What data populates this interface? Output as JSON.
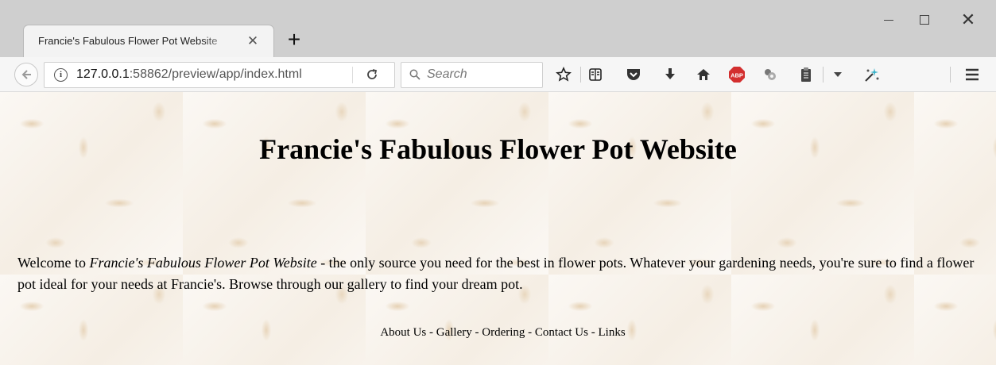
{
  "browser": {
    "tab": {
      "title": "Francie's Fabulous Flower Pot Website",
      "close_glyph": "✕"
    },
    "new_tab_glyph": "+",
    "window_controls": {
      "minimize": "",
      "maximize": "",
      "close": "✕"
    },
    "address": {
      "host": "127.0.0.1",
      "rest": ":58862/preview/app/index.html"
    },
    "search": {
      "placeholder": "Search"
    },
    "toolbar_icons": [
      "star-icon",
      "reading-list-icon",
      "pocket-icon",
      "download-icon",
      "home-icon",
      "adblock-icon",
      "extension-icon",
      "clipboard-icon",
      "dropdown-icon",
      "sparkle-extension-icon",
      "menu-icon"
    ],
    "adblock_label": "ABP"
  },
  "page": {
    "title": "Francie's Fabulous Flower Pot Website",
    "intro": {
      "before": "Welcome to ",
      "emphasis": "Francie's Fabulous Flower Pot Website",
      "after": " - the only source you need for the best in flower pots. Whatever your gardening needs, you're sure to find a flower pot ideal for your needs at Francie's. Browse through our gallery to find your dream pot."
    },
    "nav": {
      "links": [
        "About Us",
        "Gallery",
        "Ordering",
        "Contact Us",
        "Links"
      ],
      "separator": " - "
    }
  },
  "colors": {
    "titlebar": "#cfcfcf",
    "toolbar": "#f6f6f6",
    "page_bg": "#f7f2ec",
    "adblock_red": "#d32f2f"
  }
}
